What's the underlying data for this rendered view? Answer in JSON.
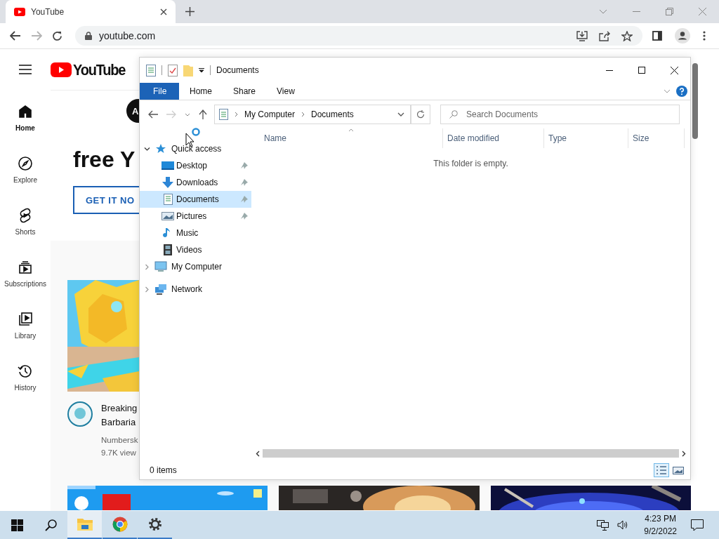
{
  "browser": {
    "tab": {
      "title": "YouTube"
    },
    "nav_buttons": [
      {
        "kind": "back",
        "disabled": false
      },
      {
        "kind": "forward",
        "disabled": true
      },
      {
        "kind": "reload",
        "disabled": false
      }
    ],
    "address": "youtube.com"
  },
  "youtube": {
    "logo_text": "YouTube",
    "sidebar": [
      {
        "kind": "home",
        "label": "Home",
        "selected": true
      },
      {
        "kind": "explore",
        "label": "Explore",
        "selected": false
      },
      {
        "kind": "shorts",
        "label": "Shorts",
        "selected": false
      },
      {
        "kind": "subscriptions",
        "label": "Subscriptions",
        "selected": false
      },
      {
        "kind": "library",
        "label": "Library",
        "selected": false
      },
      {
        "kind": "history",
        "label": "History",
        "selected": false
      }
    ],
    "banner": {
      "chip": "A",
      "heading": "free Y",
      "button": "GET IT NO"
    },
    "video": {
      "title_lines": [
        "Breaking",
        "Barbaria"
      ],
      "channel": "Numbersk",
      "views": "9.7K view"
    }
  },
  "explorer": {
    "title": "Documents",
    "ribbon_tabs": [
      {
        "kind": "menu",
        "label": "File"
      },
      {
        "kind": "tab",
        "label": "Home"
      },
      {
        "kind": "tab",
        "label": "Share"
      },
      {
        "kind": "tab",
        "label": "View"
      }
    ],
    "path": [
      "My Computer",
      "Documents"
    ],
    "search": {
      "placeholder": "Search Documents"
    },
    "columns": [
      "Name",
      "Date modified",
      "Type",
      "Size"
    ],
    "empty_message": "This folder is empty.",
    "nav": [
      {
        "kind": "quick-access",
        "label": "Quick access",
        "expanded": true,
        "selected": false,
        "children": [
          {
            "kind": "desktop",
            "label": "Desktop",
            "pinned": true,
            "selected": false
          },
          {
            "kind": "downloads",
            "label": "Downloads",
            "pinned": true,
            "selected": false
          },
          {
            "kind": "documents",
            "label": "Documents",
            "pinned": true,
            "selected": true
          },
          {
            "kind": "pictures",
            "label": "Pictures",
            "pinned": true,
            "selected": false
          },
          {
            "kind": "music",
            "label": "Music",
            "pinned": false,
            "selected": false
          },
          {
            "kind": "videos",
            "label": "Videos",
            "pinned": false,
            "selected": false
          }
        ]
      },
      {
        "kind": "computer",
        "label": "My Computer",
        "expanded": false,
        "selected": false
      },
      {
        "kind": "network",
        "label": "Network",
        "expanded": false,
        "selected": false
      }
    ],
    "status": "0 items",
    "views": [
      {
        "kind": "details",
        "selected": true
      },
      {
        "kind": "large-icons",
        "selected": false
      }
    ]
  },
  "taskbar": {
    "apps": [
      {
        "kind": "explorer",
        "active": true
      },
      {
        "kind": "chrome",
        "active": false
      },
      {
        "kind": "settings",
        "active": false
      }
    ],
    "time": "4:23 PM",
    "date": "9/2/2022"
  }
}
